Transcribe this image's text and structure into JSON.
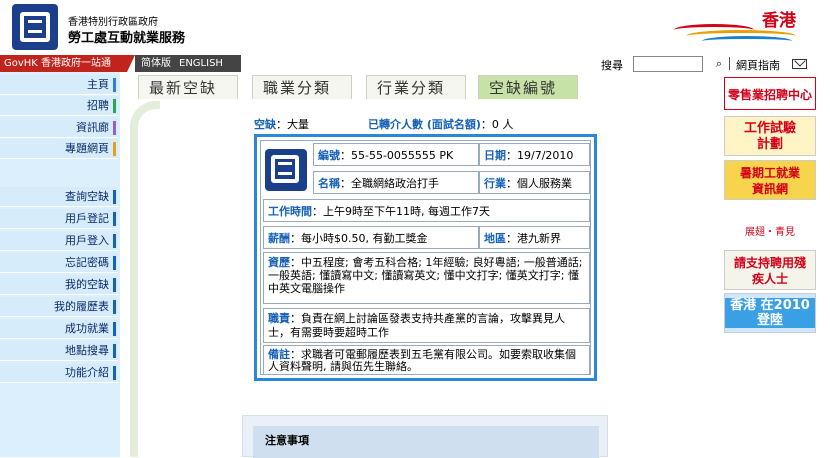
{
  "header": {
    "dept_line1": "香港特別行政區政府",
    "dept_line2": "勞工處互動就業服務",
    "brand_text": "香港"
  },
  "topbar": {
    "govhk_label": "GovHK 香港政府一站通",
    "lang_simplified": "简体版",
    "lang_english": "ENGLISH",
    "search_label": "搜尋",
    "search_placeholder": "",
    "search_button": "⌕",
    "sitemap_label": "網頁指南"
  },
  "sidebar": {
    "items": [
      {
        "label": "主頁",
        "color": "#2e7fd6"
      },
      {
        "label": "招聘",
        "color": "#27a84a"
      },
      {
        "label": "資訊廊",
        "color": "#9a5bd6"
      },
      {
        "label": "專題網頁",
        "color": "#e3a11a"
      },
      {
        "label": "查詢空缺",
        "color": "#1561b7"
      },
      {
        "label": "用戶登記",
        "color": "#1561b7"
      },
      {
        "label": "用戶登入",
        "color": "#1561b7"
      },
      {
        "label": "忘記密碼",
        "color": "#1561b7"
      },
      {
        "label": "我的空缺",
        "color": "#1561b7"
      },
      {
        "label": "我的履歷表",
        "color": "#1561b7"
      },
      {
        "label": "成功就業",
        "color": "#1561b7"
      },
      {
        "label": "地點搜尋",
        "color": "#1561b7"
      },
      {
        "label": "功能介紹",
        "color": "#1561b7"
      }
    ]
  },
  "tabs": [
    {
      "label": "最新空缺",
      "active": false
    },
    {
      "label": "職業分類",
      "active": false
    },
    {
      "label": "行業分類",
      "active": false
    },
    {
      "label": "空缺編號",
      "active": true
    }
  ],
  "summary": {
    "vacancy_label": "空缺",
    "vacancy_value": "：大量",
    "referred_label": "已轉介人數 (面試名額)",
    "referred_value": "：0 人"
  },
  "job": {
    "number_label": "編號",
    "number_value": "55-55-0055555 PK",
    "date_label": "日期",
    "date_value": "19/7/2010",
    "title_label": "名稱",
    "title_value": "全職網絡政治打手",
    "industry_label": "行業",
    "industry_value": "個人服務業",
    "hours_label": "工作時間",
    "hours_value": "上午9時至下午11時, 每週工作7天",
    "salary_label": "薪酬",
    "salary_value": "每小時$0.50, 有勤工獎金",
    "region_label": "地區",
    "region_value": "港九新界",
    "requirements_label": "資歷",
    "requirements_value": "中五程度; 會考五科合格; 1年經驗; 良好粵語; 一般普通話; 一般英語; 懂讀寫中文; 懂讀寫英文; 懂中文打字; 懂英文打字; 懂中英文電腦操作",
    "duties_label": "職責",
    "duties_value": "負責在網上討論區發表支持共產黨的言論，攻擊異見人士，有需要時要超時工作",
    "remarks_label": "備註",
    "remarks_value": "求職者可電郵履歷表到五毛黨有限公司。如要索取收集個人資料聲明, 請與伍先生聯絡。"
  },
  "notice": {
    "title": "注意事項"
  },
  "banners": [
    {
      "text": "零售業招聘中心"
    },
    {
      "text": "工作試驗計劃"
    },
    {
      "text": "暑期工就業資訊網"
    },
    {
      "text": "展翅・青見"
    },
    {
      "text": "請支持聘用殘疾人士"
    },
    {
      "text": "香港 在2010登陸"
    }
  ]
}
